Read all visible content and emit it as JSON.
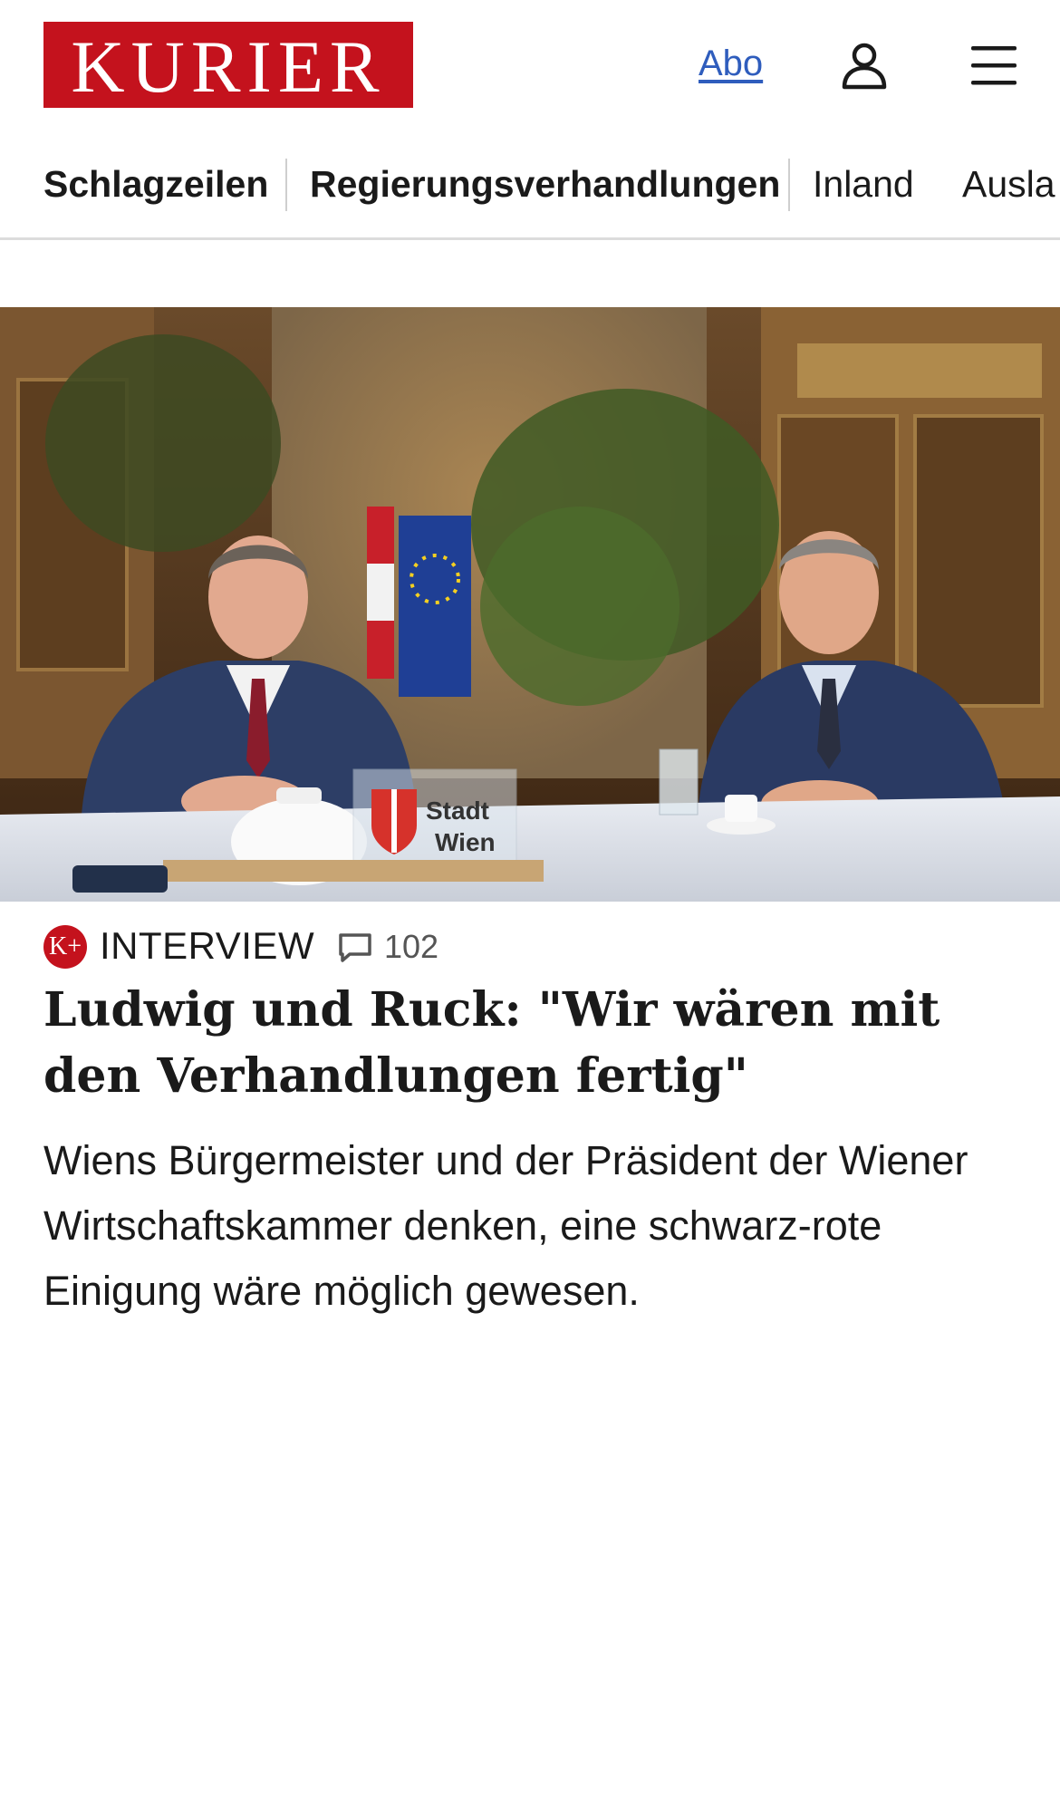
{
  "header": {
    "logo_text": "KURIER",
    "abo_label": "Abo",
    "user_icon": "user-icon",
    "menu_icon": "hamburger-menu-icon"
  },
  "nav": {
    "items": [
      {
        "label": "Schlagzeilen"
      },
      {
        "label": "Regierungsverhandlungen"
      },
      {
        "label": "Inland"
      },
      {
        "label": "Ausla"
      }
    ]
  },
  "article": {
    "badge_text": "K+",
    "category": "INTERVIEW",
    "comment_icon": "comment-icon",
    "comment_count": "102",
    "headline": "Ludwig und Ruck: \"Wir wären mit den Verhandlungen fertig\"",
    "teaser": "Wiens Bürgermeister und der Präsident der Wiener Wirtschaftskammer denken, eine schwarz-rote Einigung wäre möglich gewesen.",
    "image_sign_text": "Stadt Wien"
  },
  "colors": {
    "brand_red": "#c4121d",
    "link_blue": "#2f5dbd",
    "text": "#1a1a1a"
  }
}
